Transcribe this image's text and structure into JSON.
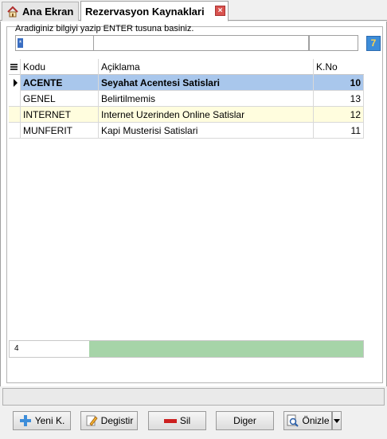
{
  "tabs": {
    "home_label": "Ana Ekran",
    "active_label": "Rezervasyon Kaynaklari",
    "close_glyph": "×"
  },
  "search": {
    "hint": "Aradiginiz bilgiyi yazip ENTER tusuna basiniz.",
    "code_value": "",
    "desc_value": "",
    "no_value": "",
    "caret_glyph": "*",
    "filter_glyph": "7"
  },
  "grid": {
    "columns": [
      "Kodu",
      "Açiklama",
      "K.No"
    ],
    "rows": [
      {
        "kodu": "ACENTE",
        "aciklama": "Seyahat Acentesi Satislari",
        "kno": "10",
        "selected": true
      },
      {
        "kodu": "GENEL",
        "aciklama": "Belirtilmemis",
        "kno": "13",
        "selected": false
      },
      {
        "kodu": "INTERNET",
        "aciklama": "Internet Uzerinden Online Satislar",
        "kno": "12",
        "selected": false
      },
      {
        "kodu": "MUNFERIT",
        "aciklama": "Kapi Musterisi Satislari",
        "kno": "11",
        "selected": false
      }
    ],
    "record_count": "4"
  },
  "buttons": {
    "yeni": "Yeni K.",
    "degistir": "Degistir",
    "sil": "Sil",
    "diger": "Diger",
    "onizle": "Önizle"
  },
  "colors": {
    "selected_row": "#a9c7ec",
    "alt_row": "#fffdde",
    "footer_bar": "#a6d4a8",
    "accent_blue": "#3d8dd9"
  }
}
